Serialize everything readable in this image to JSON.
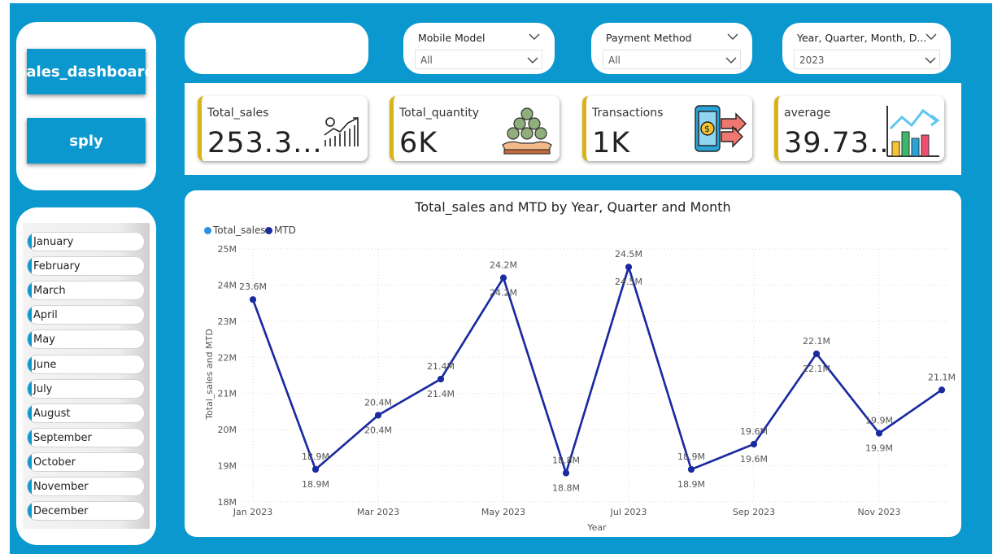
{
  "nav": {
    "sales_dashboard_label": "sales_dashboard",
    "sply_label": "sply"
  },
  "months": [
    "January",
    "February",
    "March",
    "April",
    "May",
    "June",
    "July",
    "August",
    "September",
    "October",
    "November",
    "December"
  ],
  "slicers": [
    {
      "title": "Mobile Model",
      "value": "All"
    },
    {
      "title": "Payment Method",
      "value": "All"
    },
    {
      "title": "Year, Quarter, Month, D...",
      "value": "2023"
    }
  ],
  "kpis": [
    {
      "label": "Total_sales",
      "value": "253.3...",
      "icon": "growth-chart-icon"
    },
    {
      "label": "Total_quantity",
      "value": "6K",
      "icon": "money-bags-icon"
    },
    {
      "label": "Transactions",
      "value": "1K",
      "icon": "mobile-payment-icon"
    },
    {
      "label": "average",
      "value": "39.73...",
      "icon": "bar-chart-icon"
    }
  ],
  "colors": {
    "background": "#0a98cf",
    "kpi_accent": "#d8b31a",
    "total_sales_series": "#2b8fe6",
    "mtd_series": "#1a2aa0"
  },
  "chart_data": {
    "type": "line",
    "title": "Total_sales and MTD by Year, Quarter and Month",
    "xlabel": "Year",
    "ylabel": "Total_sales and MTD",
    "ylim": [
      18,
      25
    ],
    "y_unit": "M",
    "y_ticks": [
      "18M",
      "19M",
      "20M",
      "21M",
      "22M",
      "23M",
      "24M",
      "25M"
    ],
    "x_tick_labels": [
      "Jan 2023",
      "Mar 2023",
      "May 2023",
      "Jul 2023",
      "Sep 2023",
      "Nov 2023"
    ],
    "categories": [
      "Jan 2023",
      "Feb 2023",
      "Mar 2023",
      "Apr 2023",
      "May 2023",
      "Jun 2023",
      "Jul 2023",
      "Aug 2023",
      "Sep 2023",
      "Oct 2023",
      "Nov 2023",
      "Dec 2023"
    ],
    "legend_position": "top-left",
    "grid": true,
    "series": [
      {
        "name": "Total_sales",
        "values": [
          23.6,
          18.9,
          20.4,
          21.4,
          24.2,
          18.8,
          24.5,
          18.9,
          19.6,
          22.1,
          19.9,
          21.1
        ],
        "labels": [
          "23.6M",
          "18.9M",
          "20.4M",
          "21.4M",
          "24.2M",
          "18.8M",
          "24.5M",
          "18.9M",
          "19.6M",
          "22.1M",
          "19.9M",
          "21.1M"
        ]
      },
      {
        "name": "MTD",
        "values": [
          23.6,
          18.9,
          20.4,
          21.4,
          24.2,
          18.8,
          24.5,
          18.9,
          19.6,
          22.1,
          19.9,
          21.1
        ],
        "labels": [
          "",
          "18.9M",
          "20.4M",
          "21.4M",
          "24.2M",
          "18.8M",
          "24.5M",
          "18.9M",
          "19.6M",
          "22.1M",
          "19.9M",
          ""
        ]
      }
    ]
  }
}
